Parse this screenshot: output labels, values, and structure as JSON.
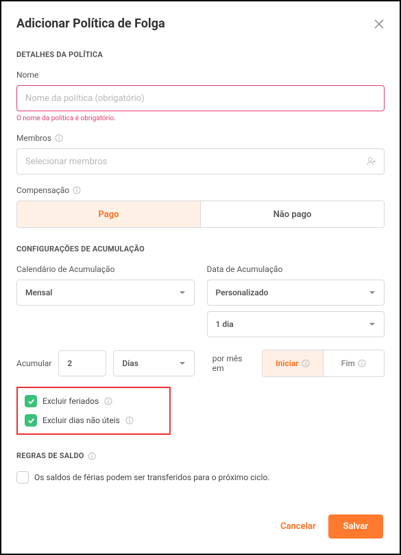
{
  "header": {
    "title": "Adicionar Política de Folga"
  },
  "policy_details": {
    "section_title": "DETALHES DA POLÍTICA",
    "name_label": "Nome",
    "name_placeholder": "Nome da política (obrigatório)",
    "name_error": "O nome da política é obrigatório.",
    "members_label": "Membros",
    "members_placeholder": "Selecionar membros",
    "compensation_label": "Compensação",
    "compensation_options": {
      "paid": "Pago",
      "unpaid": "Não pago"
    },
    "compensation_selected": "paid"
  },
  "accrual": {
    "section_title": "CONFIGURAÇÕES DE ACUMULAÇÃO",
    "schedule_label": "Calendário de Acumulação",
    "schedule_value": "Mensal",
    "date_label": "Data de Acumulação",
    "date_value": "Personalizado",
    "date_custom_value": "1 dia",
    "accrue_label": "Acumular",
    "accrue_amount": "2",
    "accrue_unit": "Dias",
    "per_month_text": "por mês em",
    "timing_options": {
      "start": "Iniciar",
      "end": "Fim"
    },
    "timing_selected": "start",
    "exclude_holidays": "Excluir feriados",
    "exclude_nonwork": "Excluir dias não úteis"
  },
  "balance": {
    "section_title": "REGRAS DE SALDO",
    "carryover_text": "Os saldos de férias podem ser transferidos para o próximo ciclo."
  },
  "footer": {
    "cancel": "Cancelar",
    "save": "Salvar"
  }
}
